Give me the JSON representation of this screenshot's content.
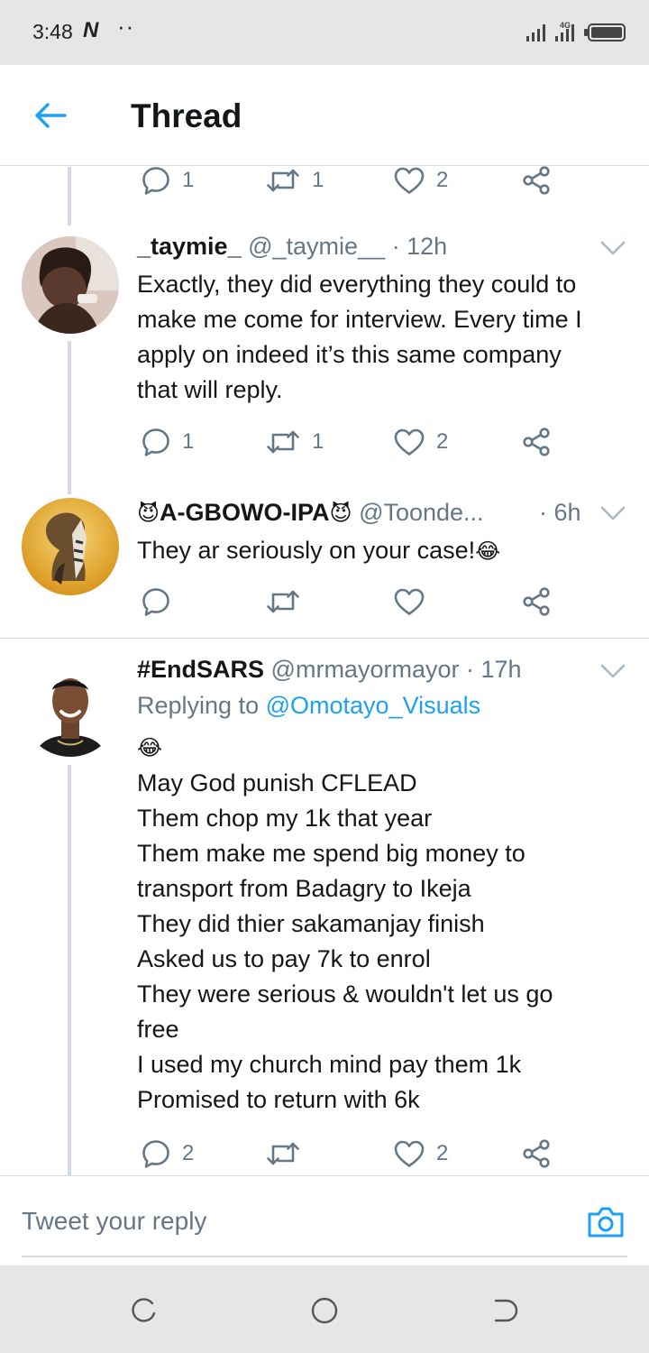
{
  "status_bar": {
    "time": "3:48",
    "carrier_glyph": "N",
    "dots": "··",
    "network": "4G"
  },
  "header": {
    "title": "Thread",
    "back_icon": "arrow-left-icon"
  },
  "prev_actions": {
    "replies": "1",
    "retweets": "1",
    "likes": "2"
  },
  "tweets": [
    {
      "name": "_taymie_",
      "handle": "@_taymie__",
      "time": "· 12h",
      "lines": [
        "Exactly, they did everything they could to",
        "make me come for interview. Every time I",
        "apply on indeed it’s this same company",
        "that will reply."
      ],
      "replies": "1",
      "retweets": "1",
      "likes": "2"
    },
    {
      "name_prefix_emoji": "😈",
      "name": "A-GBOWO-IPA",
      "name_suffix_emoji": "😈",
      "handle": "@Toonde...",
      "time": "· 6h",
      "text": "They ar seriously on your case!",
      "text_emoji": "😂",
      "replies": "",
      "retweets": "",
      "likes": ""
    },
    {
      "name": "#EndSARS",
      "handle": "@mrmayormayor",
      "time": "· 17h",
      "replying_label": "Replying to",
      "replying_to": "@Omotayo_Visuals",
      "emoji_line": "😂",
      "lines": [
        "May God punish CFLEAD",
        "Them chop my 1k that year",
        "Them make me spend big money to",
        "transport from Badagry to Ikeja",
        "They did thier sakamanjay finish",
        "Asked us to pay 7k to enrol",
        "They were serious & wouldn't let us go",
        "free",
        "I used my church mind pay them 1k",
        "Promised to return with 6k"
      ],
      "replies": "2",
      "retweets": "",
      "likes": "2"
    }
  ],
  "composer": {
    "placeholder": "Tweet your reply",
    "camera_icon": "camera-icon"
  },
  "nav": {
    "recents": "recents-icon",
    "home": "home-icon",
    "back": "back-icon"
  },
  "colors": {
    "accent": "#1da1f2",
    "muted": "#657786",
    "text": "#14171a",
    "divider": "#d6dbe0"
  }
}
